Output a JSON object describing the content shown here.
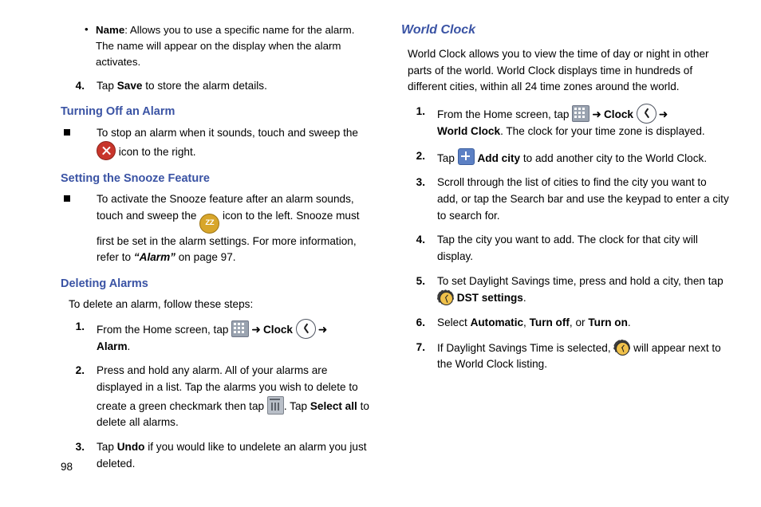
{
  "page": {
    "number": "98"
  },
  "left_column": {
    "bullet_name": {
      "term": "Name",
      "text": ": Allows you to use a specific name for the alarm. The name will appear on the display when the alarm activates."
    },
    "step4": {
      "num": "4.",
      "pre": "Tap ",
      "bold": "Save",
      "post": " to store the alarm details."
    },
    "heading_turning_off": "Turning Off an Alarm",
    "turning_off_item": {
      "pre": "To stop an alarm when it sounds, touch and sweep the ",
      "post": " icon to the right."
    },
    "heading_snooze": "Setting the Snooze Feature",
    "snooze_item": {
      "pre": "To activate the Snooze feature after an alarm sounds, touch and sweep the ",
      "mid": " icon to the left. Snooze must first be set in the alarm settings. For more information, refer to ",
      "ref": "“Alarm”",
      "post": " on page 97."
    },
    "heading_deleting": "Deleting Alarms",
    "delete_intro": "To delete an alarm, follow these steps:",
    "d_step1": {
      "num": "1.",
      "pre": "From the Home screen, tap ",
      "clock_label": "Clock",
      "alarm_label": "Alarm",
      "period": "."
    },
    "d_step2": {
      "num": "2.",
      "pre": "Press and hold any alarm. All of your alarms are displayed in a list. Tap the alarms you wish to delete to create a green checkmark then tap ",
      "mid": ". Tap ",
      "bold": "Select all",
      "post": " to delete all alarms."
    },
    "d_step3": {
      "num": "3.",
      "pre": "Tap ",
      "bold": "Undo",
      "post": " if you would like to undelete an alarm you just deleted."
    }
  },
  "right_column": {
    "heading_world_clock": "World Clock",
    "intro": "World Clock allows you to view the time of day or night in other parts of the world. World Clock displays time in hundreds of different cities, within all 24 time zones around the world.",
    "step1": {
      "num": "1.",
      "pre": "From the Home screen, tap ",
      "clock_label": "Clock",
      "world_clock_label": "World Clock",
      "post": ". The clock for your time zone is displayed."
    },
    "step2": {
      "num": "2.",
      "pre": "Tap ",
      "bold": "Add city",
      "post": " to add another city to the World Clock."
    },
    "step3": {
      "num": "3.",
      "text": "Scroll through the list of cities to find the city you want to add, or tap the Search bar and use the keypad to enter a city to search for."
    },
    "step4": {
      "num": "4.",
      "text": "Tap the city you want to add. The clock for that city will display."
    },
    "step5": {
      "num": "5.",
      "pre": "To set Daylight Savings time, press and hold a city, then tap ",
      "bold": "DST settings",
      "post": "."
    },
    "step6": {
      "num": "6.",
      "pre": "Select ",
      "b1": "Automatic",
      "sep1": ", ",
      "b2": "Turn off",
      "sep2": ", or ",
      "b3": "Turn on",
      "post": "."
    },
    "step7": {
      "num": "7.",
      "pre": "If Daylight Savings Time is selected, ",
      "post": " will appear next to the World Clock listing."
    }
  },
  "icons": {
    "apps": "apps-grid-icon",
    "clock": "clock-icon",
    "stop_alarm": "stop-alarm-icon",
    "snooze": "snooze-icon",
    "add": "plus-icon",
    "trash": "trash-icon",
    "dst": "dst-settings-icon"
  },
  "colors": {
    "heading": "#3a53a4",
    "snooze": "#d8a62b",
    "stop": "#c8352b",
    "add": "#5c80c4"
  }
}
